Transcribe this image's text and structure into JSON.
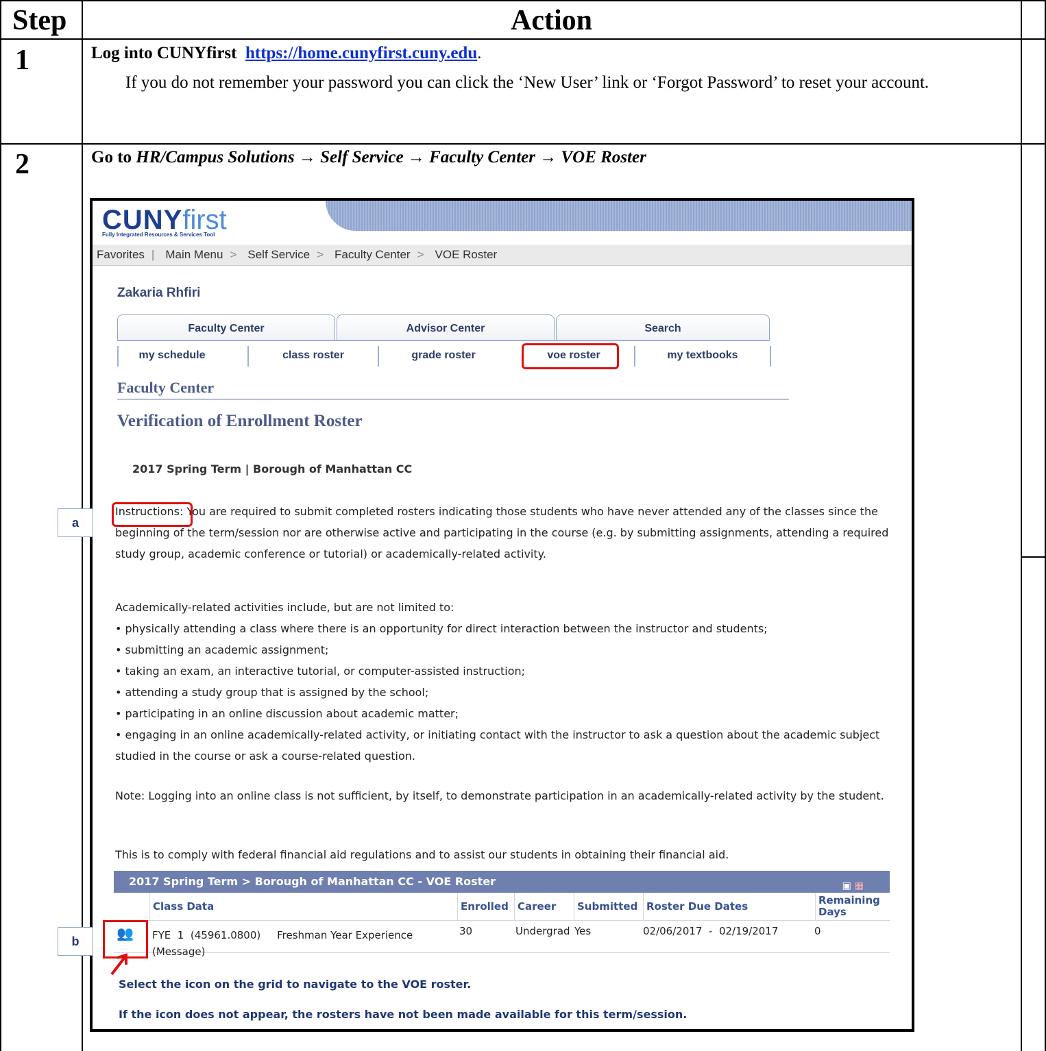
{
  "table": {
    "col_step": "Step",
    "col_action": "Action"
  },
  "step1": {
    "number": "1",
    "lead": "Log into CUNYfirst",
    "link": "https://home.cunyfirst.cuny.edu",
    "after_link": ".",
    "detail": "If you do not remember your password you can click the ‘New User’ link or ‘Forgot Password’ to reset your account."
  },
  "step2": {
    "number": "2",
    "lead": "Go to",
    "path": "HR/Campus Solutions → Self Service → Faculty Center → VOE Roster"
  },
  "app": {
    "logo_cuny": "CUNY",
    "logo_first": "first",
    "logo_tagline": "Fully Integrated Resources & Services Tool",
    "nav": [
      "Favorites",
      "Main Menu",
      ">",
      "Self Service",
      ">",
      "Faculty Center",
      ">",
      "VOE Roster"
    ],
    "person_name": "Zakaria Rhfiri",
    "tabs": [
      "Faculty Center",
      "Advisor Center",
      "Search"
    ],
    "subtabs": [
      "my schedule",
      "class roster",
      "grade roster",
      "voe roster",
      "my textbooks"
    ],
    "section_title": "Faculty Center",
    "page_title": "Verification of Enrollment Roster",
    "term_line": "2017 Spring Term | Borough of Manhattan CC",
    "instructions_label": "Instructions",
    "instructions_text": ": You are required to submit completed rosters indicating those students who have never attended any of the classes since the beginning of the term/session nor are otherwise active and participating in the course (e.g. by submitting assignments, attending a required study group, academic conference or tutorial) or academically-related activity.",
    "activities_intro": "Academically-related activities include, but are not limited to:",
    "activities": [
      "• physically attending a class where there is an opportunity for direct interaction between the instructor and students;",
      "• submitting an academic assignment;",
      "• taking an exam, an interactive tutorial, or computer-assisted instruction;",
      "• attending a study group that is assigned by the school;",
      "• participating in an online discussion about academic matter;",
      "• engaging in an online academically-related activity, or initiating contact with the instructor to ask a question about the academic subject studied in the course or ask a course-related question."
    ],
    "note": "Note: Logging into an online class is not sufficient, by itself, to demonstrate participation in an academically-related activity by the student.",
    "comply": "This is to comply with federal financial aid regulations and to assist our students in obtaining their financial aid.",
    "grid_title": "2017 Spring Term > Borough of Manhattan CC - VOE Roster",
    "grid_headers": [
      "Class Data",
      "Enrolled",
      "Career",
      "Submitted",
      "Roster Due Dates",
      "Remaining Days"
    ],
    "grid_row": {
      "class_data": "FYE  1  (45961.0800)     Freshman Year Experience",
      "message": "(Message)",
      "enrolled": "30",
      "career": "Undergrad",
      "submitted": "Yes",
      "due_dates": "02/06/2017  -  02/19/2017",
      "remaining": "0"
    },
    "hint1": "Select the icon on the grid to navigate to the VOE roster.",
    "hint2": "If the icon does not appear, the rosters have not been made available for this term/session."
  },
  "callouts": {
    "a": "a",
    "b": "b"
  },
  "colors": {
    "highlight": "#e01010",
    "link": "#0b2fd1",
    "grid_header": "#6f7fb0"
  }
}
